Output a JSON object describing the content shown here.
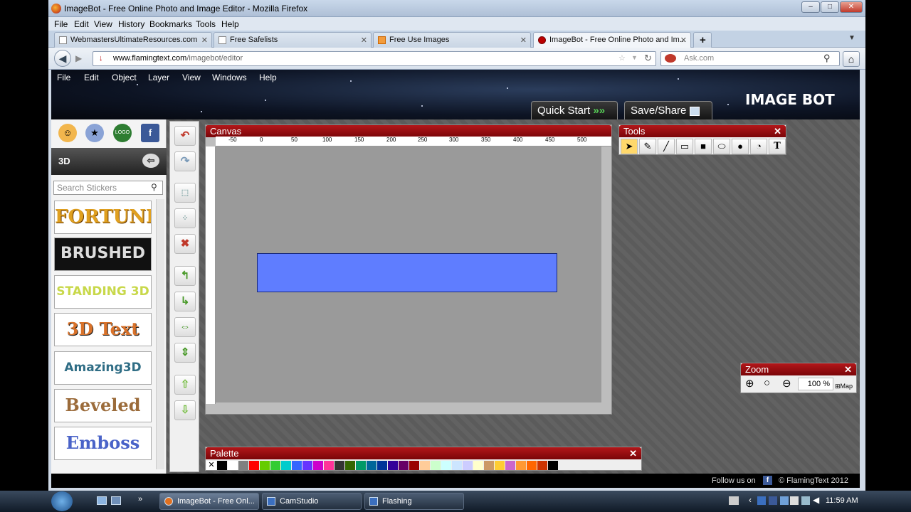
{
  "window": {
    "title": "ImageBot - Free Online Photo and Image Editor - Mozilla Firefox"
  },
  "browser_menu": [
    "File",
    "Edit",
    "View",
    "History",
    "Bookmarks",
    "Tools",
    "Help"
  ],
  "tabs": [
    {
      "label": "WebmastersUltimateResources.com"
    },
    {
      "label": "Free Safelists"
    },
    {
      "label": "Free Use Images"
    },
    {
      "label": "ImageBot - Free Online Photo and Im...",
      "active": true
    }
  ],
  "url": {
    "domain": "www.flamingtext.com",
    "path": "/imagebot/editor"
  },
  "search": {
    "placeholder": "Ask.com"
  },
  "app_menu": [
    "File",
    "Edit",
    "Object",
    "Layer",
    "View",
    "Windows",
    "Help"
  ],
  "header": {
    "quick_start": "Quick Start",
    "save_share": "Save/Share",
    "logo": "IMAGE BOT"
  },
  "left": {
    "category": "3D",
    "search_placeholder": "Search Stickers",
    "stickers": [
      "FORTUNE",
      "BRUSHED",
      "STANDING 3D",
      "3D Text",
      "Amazing3D",
      "Beveled",
      "Emboss"
    ]
  },
  "canvas": {
    "title": "Canvas",
    "ruler": [
      "-50",
      "0",
      "50",
      "100",
      "150",
      "200",
      "250",
      "300",
      "350",
      "400",
      "450",
      "500"
    ],
    "rect_color": "#5f7dff"
  },
  "tools": {
    "title": "Tools"
  },
  "zoom": {
    "title": "Zoom",
    "value": "100",
    "unit": "%",
    "map": "Map"
  },
  "palette": {
    "title": "Palette",
    "colors": [
      "#000000",
      "#ffffff",
      "#7f7f7f",
      "#ff0000",
      "#66cc00",
      "#33cc33",
      "#00cccc",
      "#3366ff",
      "#6633ff",
      "#cc00cc",
      "#ff3399",
      "#333333",
      "#336600",
      "#009966",
      "#006699",
      "#003399",
      "#330099",
      "#660066",
      "#990000",
      "#ffcc99",
      "#ccffcc",
      "#ccffff",
      "#cce5ff",
      "#ccccff",
      "#ffffcc",
      "#cc9966",
      "#ffcc33",
      "#cc66cc",
      "#ff9933",
      "#ff6600",
      "#cc3300",
      "#000000"
    ]
  },
  "footer": {
    "follow": "Follow us on",
    "copyright": "© FlamingText 2012"
  },
  "taskbar": {
    "items": [
      "ImageBot - Free Onl...",
      "CamStudio",
      "Flashing"
    ],
    "time": "11:59 AM"
  }
}
